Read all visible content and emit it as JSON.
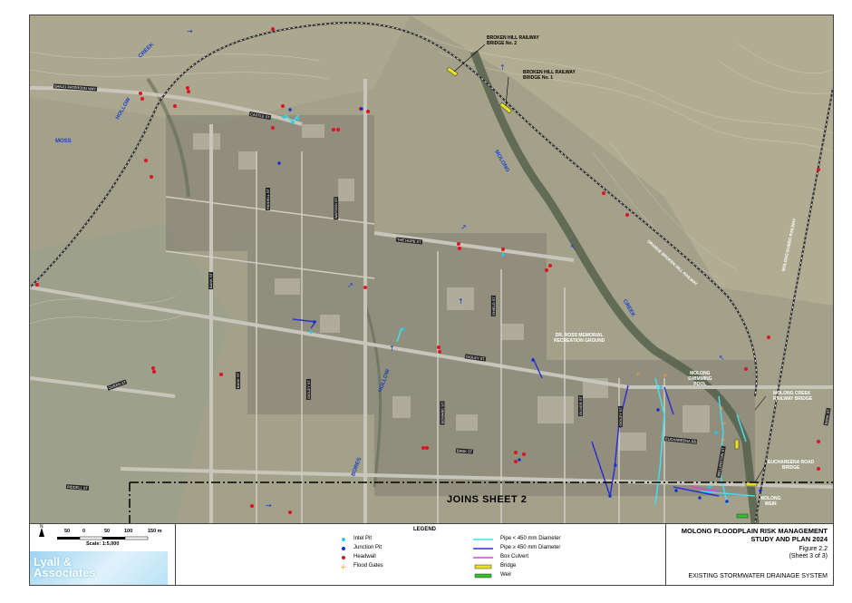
{
  "map": {
    "creek_labels": [
      "MOSS",
      "HOLLOW",
      "CREEK",
      "MOLONG",
      "CREEK",
      "HOLLOW",
      "BORES"
    ],
    "street_labels": [
      "BANJO PATERSON WAY",
      "CASTLE ST",
      "RIDDELL ST",
      "WATSON ST",
      "BANK ST",
      "GIDLEY ST",
      "BANK ST",
      "THE HOPE ST",
      "SHIELD ST",
      "GIDLEY ST",
      "EDWARD ST",
      "BANK ST",
      "QUEEN ST",
      "ORANGE BROKEN HILL RAILWAY",
      "MOLONG-DUBBO RAILWAY",
      "GIDLEY ST",
      "EUCHAREENA RD",
      "WELLINGTON ST",
      "BANK ST",
      "OLIVER ST",
      "RIDDELL ST"
    ],
    "callouts": {
      "bridge2": [
        "BROKEN HILL RAILWAY",
        "BRIDGE No. 2"
      ],
      "bridge1": [
        "BROKEN HILL RAILWAY",
        "BRIDGE No. 1"
      ],
      "ross": [
        "DR. ROSS MEMORIAL",
        "RECREATION GROUND"
      ],
      "pool": [
        "MOLONG",
        "SWIMMING",
        "POOL"
      ],
      "creekbridge": [
        "MOLONG CREEK",
        "RAILWAY BRIDGE"
      ],
      "euch": [
        "EUCHAREENA ROAD",
        "BRIDGE"
      ],
      "weir": [
        "MOLONG",
        "WEIR"
      ]
    },
    "joins": "JOINS SHEET 2"
  },
  "scale": {
    "north": "N",
    "ticks": [
      "50",
      "0",
      "50",
      "100",
      "150 m"
    ],
    "label": "Scale: 1:5,000"
  },
  "logo": {
    "line1": "Lyall &",
    "line2": "Associates"
  },
  "legend": {
    "title": "LEGEND",
    "items_left": [
      "Intel Pit",
      "Junction Pit",
      "Headwall",
      "Flood Gates"
    ],
    "items_right": [
      "Pipe < 450 mm Diameter",
      "Pipe ≥ 450 mm Diameter",
      "Box Culvert",
      "Bridge",
      "Weir"
    ]
  },
  "title_block": {
    "title": [
      "MOLONG FLOODPLAIN RISK MANAGEMENT",
      "STUDY AND PLAN 2024"
    ],
    "figure": [
      "Figure 2.2",
      "(Sheet 3 of 3)"
    ],
    "subtitle": "EXISTING STORMWATER DRAINAGE SYSTEM"
  },
  "colors": {
    "intel_pit": "#29c8e8",
    "junction_pit": "#1030d0",
    "headwall": "#e01020",
    "flood_gates": "#f0a040",
    "pipe_small": "#40e0f0",
    "pipe_large": "#3030d0",
    "box_culvert": "#e040e0",
    "bridge": "#e8e020",
    "weir": "#30c030"
  }
}
